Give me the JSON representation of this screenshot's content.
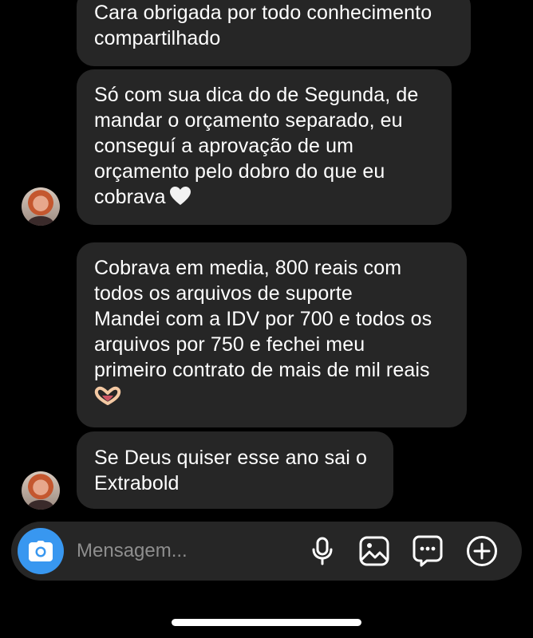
{
  "messages": [
    {
      "lines": [
        "Cara obrigada por todo conhecimento",
        "compartilhado"
      ]
    },
    {
      "lines": [
        "Só com sua dica do de Segunda, de",
        "mandar o orçamento separado, eu",
        "conseguí a aprovação de um",
        "orçamento pelo dobro do que eu",
        "cobrava"
      ],
      "emoji": "white-heart-icon"
    },
    {
      "lines": [
        "Cobrava em media, 800 reais com",
        "todos os arquivos de suporte",
        "Mandei com a IDV por 700 e todos os",
        "arquivos por 750 e fechei meu",
        "primeiro contrato de mais de mil reais"
      ],
      "emoji": "heart-hands-icon"
    },
    {
      "lines": [
        "Se Deus quiser esse ano sai o",
        "Extrabold"
      ]
    }
  ],
  "composer": {
    "placeholder": "Mensagem...",
    "icons": [
      "camera-icon",
      "microphone-icon",
      "gallery-icon",
      "sticker-chat-icon",
      "plus-circle-icon"
    ]
  },
  "colors": {
    "background": "#000000",
    "bubble": "#262626",
    "camera_button": "#3897f0",
    "placeholder": "#8e8e8e"
  }
}
